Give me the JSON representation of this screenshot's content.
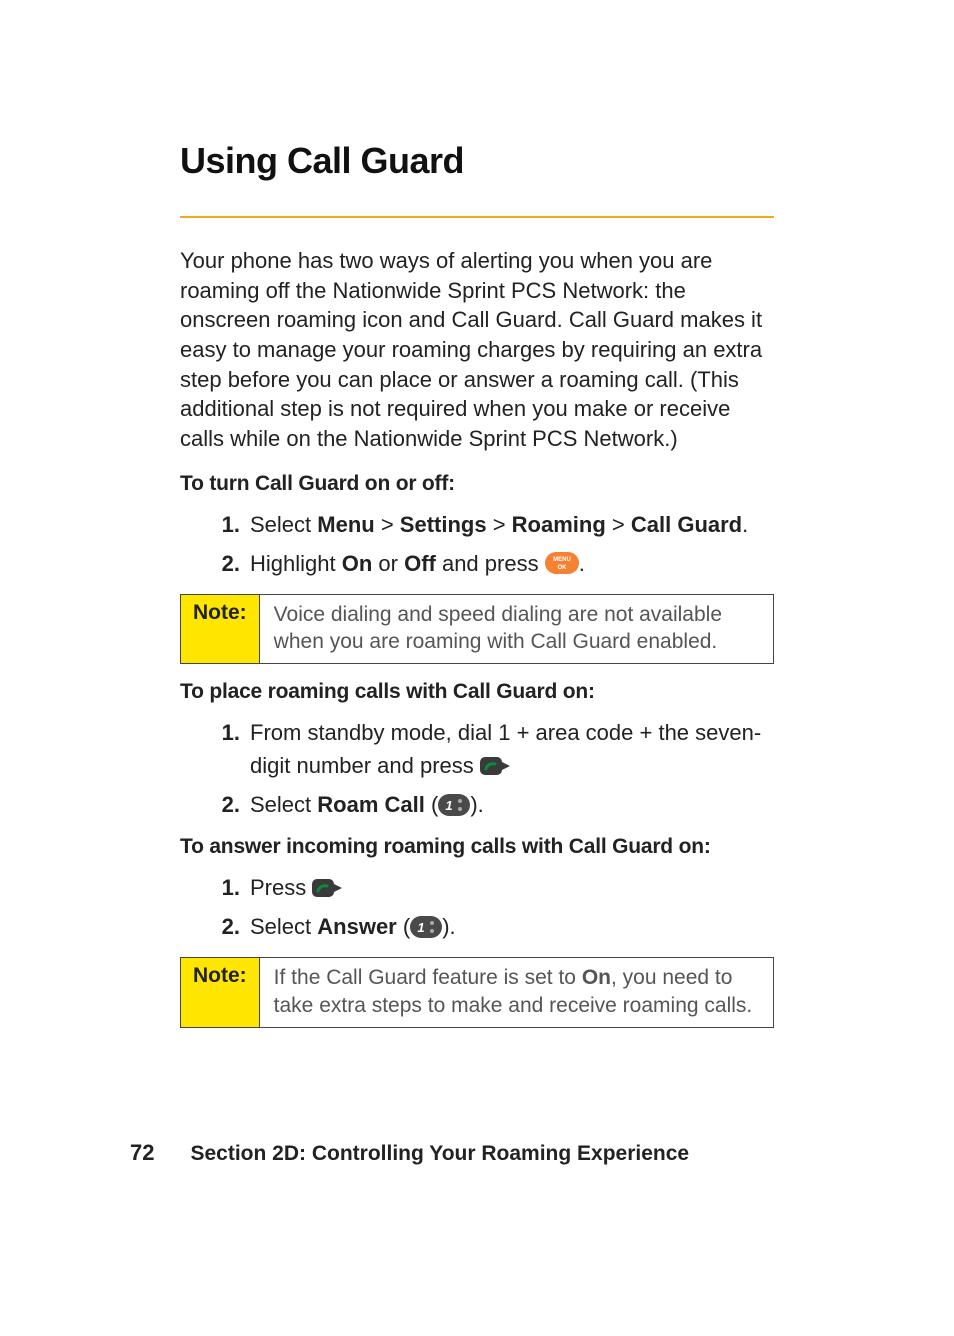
{
  "title": "Using Call Guard",
  "intro": "Your phone has two ways of alerting you when you are roaming off the Nationwide Sprint PCS Network: the onscreen roaming icon and Call Guard. Call Guard makes it easy to manage your roaming charges by requiring an extra step before you can place or answer a roaming call. (This additional step is not required when you make or receive calls while on the Nationwide Sprint PCS Network.)",
  "subheads": {
    "turn": "To turn Call Guard on or off:",
    "place": "To place roaming calls with Call Guard on:",
    "answer": "To answer incoming roaming calls with Call Guard on:"
  },
  "steps_turn": {
    "s1": {
      "num": "1.",
      "pre": "Select ",
      "m1": "Menu",
      "sep1": " > ",
      "m2": "Settings",
      "sep2": " > ",
      "m3": "Roaming",
      "sep3": " > ",
      "m4": "Call Guard",
      "post": "."
    },
    "s2": {
      "num": "2.",
      "pre": "Highlight ",
      "on": "On",
      "or": " or ",
      "off": "Off",
      "post1": " and press ",
      "post2": "."
    }
  },
  "note1": {
    "label": "Note:",
    "text": "Voice dialing and speed dialing are not available when you are roaming with Call Guard enabled."
  },
  "steps_place": {
    "s1": {
      "num": "1.",
      "pre": "From standby mode, dial 1 + area code + the seven-digit number and press "
    },
    "s2": {
      "num": "2.",
      "pre": "Select ",
      "b": "Roam Call",
      "open": " (",
      "close": ")."
    }
  },
  "steps_answer": {
    "s1": {
      "num": "1.",
      "pre": "Press "
    },
    "s2": {
      "num": "2.",
      "pre": "Select ",
      "b": "Answer",
      "open": " (",
      "close": ")."
    }
  },
  "note2": {
    "label": "Note:",
    "pre": "If the Call Guard feature is set to ",
    "on": "On",
    "post": ", you need to take extra steps to make and receive roaming calls."
  },
  "footer": {
    "page": "72",
    "section": "Section 2D: Controlling Your Roaming Experience"
  }
}
